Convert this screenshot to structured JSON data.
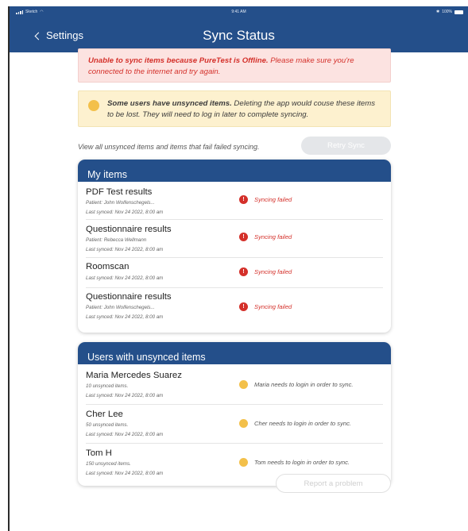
{
  "status_bar": {
    "carrier": "Sketch",
    "time": "9:41 AM",
    "battery": "100%"
  },
  "header": {
    "back_label": "Settings",
    "title": "Sync Status"
  },
  "banners": {
    "error": {
      "bold": "Unable to sync items because PureTest is Offline.",
      "text": " Please make sure you're connected to the internet and try again."
    },
    "warning": {
      "bold": "Some users have unsynced items.",
      "text": " Deleting the app would couse these items to be lost. They will need to log in later to complete syncing."
    }
  },
  "info": {
    "text": "View all unsynced items and items that fail failed syncing.",
    "retry_label": "Retry Sync"
  },
  "my_items": {
    "title": "My items",
    "items": [
      {
        "title": "PDF Test results",
        "patient": "Patient: John Wolfenschegels...",
        "last_synced": "Last synced: Nov 24 2022, 8:00 am",
        "status": "Syncing failed"
      },
      {
        "title": "Questionnaire results",
        "patient": "Patient: Rebecca Wellmann",
        "last_synced": "Last synced: Nov 24 2022, 8:00 am",
        "status": "Syncing failed"
      },
      {
        "title": "Roomscan",
        "patient": "",
        "last_synced": "Last synced: Nov 24 2022, 8:00 am",
        "status": "Syncing failed"
      },
      {
        "title": "Questionnaire results",
        "patient": "Patient: John Wolfenschegels...",
        "last_synced": "Last synced: Nov 24 2022, 8:00 am",
        "status": "Syncing failed"
      }
    ]
  },
  "users": {
    "title": "Users with unsynced items",
    "items": [
      {
        "name": "Maria Mercedes Suarez",
        "count": "10 unsynced items.",
        "last_synced": "Last synced: Nov 24 2022, 8:00 am",
        "status": "Maria needs to login in order to sync."
      },
      {
        "name": "Cher Lee",
        "count": "50 unsynced items.",
        "last_synced": "Last synced: Nov 24 2022, 8:00 am",
        "status": "Cher needs to login in order to sync."
      },
      {
        "name": "Tom H",
        "count": "150 unsynced items.",
        "last_synced": "Last synced: Nov 24 2022, 8:00 am",
        "status": "Tom needs to login in order to sync."
      }
    ]
  },
  "report_label": "Report a problem",
  "colors": {
    "header": "#244f8a",
    "error": "#d4302a",
    "warning": "#f3c04a"
  }
}
